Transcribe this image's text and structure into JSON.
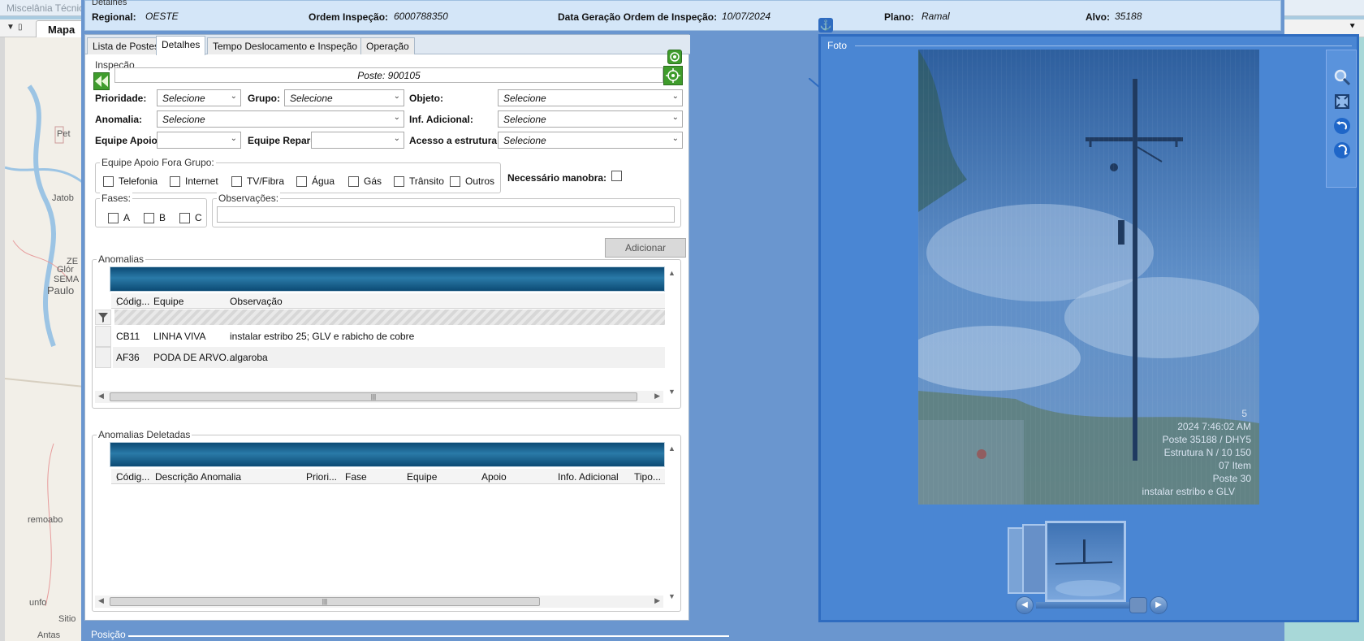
{
  "background": {
    "app_title": "Miscelânia Técnica",
    "map_tab": "Mapa",
    "map_labels": [
      "Pet",
      "Jatob",
      "ZE",
      "Glór",
      "SEMA",
      "Paulo",
      "remoabo",
      "unfo",
      "Sitio",
      "Antas"
    ]
  },
  "header": {
    "section": "Detalhes",
    "regional_label": "Regional:",
    "regional_value": "OESTE",
    "ordem_label": "Ordem Inspeção:",
    "ordem_value": "6000788350",
    "data_label": "Data Geração Ordem de Inspeção:",
    "data_value": "10/07/2024",
    "plano_label": "Plano:",
    "plano_value": "Ramal",
    "alvo_label": "Alvo:",
    "alvo_value": "35188"
  },
  "tabs": [
    "Lista de Postes",
    "Detalhes",
    "Tempo Deslocamento e Inspeção",
    "Operação"
  ],
  "inspecao": {
    "group_label": "Inspeção",
    "poste": "Poste: 900105",
    "prioridade_label": "Prioridade:",
    "prioridade_value": "Selecione",
    "grupo_label": "Grupo:",
    "grupo_value": "Selecione",
    "objeto_label": "Objeto:",
    "objeto_value": "Selecione",
    "anomalia_label": "Anomalia:",
    "anomalia_value": "Selecione",
    "inf_label": "Inf. Adicional:",
    "inf_value": "Selecione",
    "equipe_apoio_label": "Equipe Apoio:",
    "equipe_apoio_value": "",
    "equipe_reparo_label": "Equipe Reparo:",
    "equipe_reparo_value": "",
    "acesso_label": "Acesso a estrutura:",
    "acesso_value": "Selecione",
    "fora_grupo_label": "Equipe Apoio Fora Grupo:",
    "fora_grupo_options": [
      "Telefonia",
      "Internet",
      "TV/Fibra",
      "Água",
      "Gás",
      "Trânsito",
      "Outros"
    ],
    "manobra_label": "Necessário manobra:",
    "fases_label": "Fases:",
    "fases": [
      "A",
      "B",
      "C"
    ],
    "observacoes_label": "Observações:",
    "observacoes_value": "",
    "add_button": "Adicionar"
  },
  "anomalias": {
    "label": "Anomalias",
    "columns": [
      "Códig...",
      "Equipe",
      "Observação"
    ],
    "rows": [
      [
        "CB11",
        "LINHA VIVA",
        "instalar estribo 25; GLV e rabicho  de cobre"
      ],
      [
        "AF36",
        "PODA DE ARVO...",
        "algaroba"
      ]
    ]
  },
  "deletadas": {
    "label": "Anomalias Deletadas",
    "columns": [
      "Códig...",
      "Descrição Anomalia",
      "Priori...",
      "Fase",
      "Equipe",
      "Apoio",
      "Info. Adicional",
      "Tipo..."
    ]
  },
  "photo": {
    "label": "Foto",
    "overlay_lines": [
      "5",
      "2024 7:46:02 AM",
      "Poste 35188 / DHY5",
      "Estrutura N / 10 150",
      "07 Item",
      "Poste 30",
      "instalar estribo e GLV"
    ]
  },
  "posicao": {
    "label": "Posição"
  },
  "colors": {
    "accent": "#2f6cc0",
    "green": "#3f9c2c",
    "grid_band": "#0c4a74"
  }
}
